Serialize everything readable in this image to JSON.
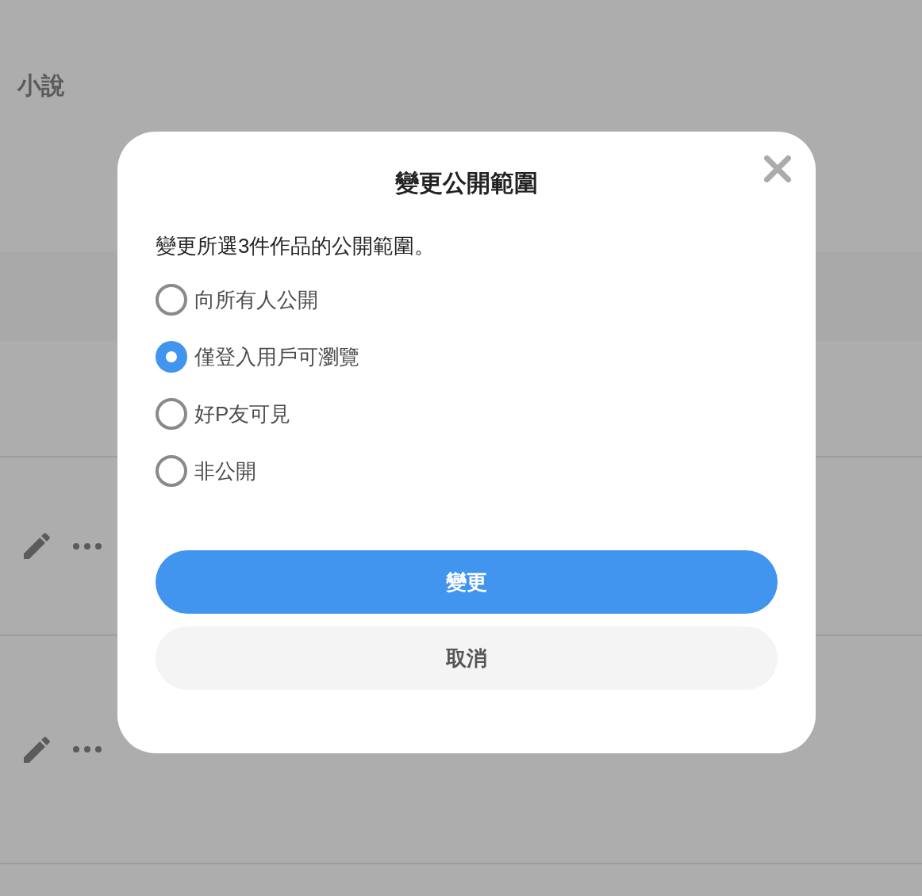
{
  "page": {
    "title": "小說"
  },
  "dialog": {
    "title": "變更公開範圍",
    "message": "變更所選3件作品的公開範圍。",
    "options": [
      {
        "label": "向所有人公開",
        "selected": false
      },
      {
        "label": "僅登入用戶可瀏覽",
        "selected": true
      },
      {
        "label": "好P友可見",
        "selected": false
      },
      {
        "label": "非公開",
        "selected": false
      }
    ],
    "buttons": [
      {
        "label": "變更",
        "kind": "primary"
      },
      {
        "label": "取消",
        "kind": "secondary"
      }
    ]
  }
}
